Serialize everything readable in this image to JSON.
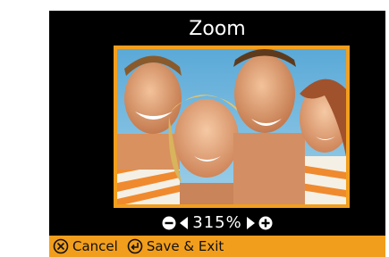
{
  "screen": {
    "title": "Zoom"
  },
  "zoom": {
    "value": "315%",
    "decrease_icon": "minus-circle-icon",
    "prev_icon": "left-triangle-icon",
    "next_icon": "right-triangle-icon",
    "increase_icon": "plus-circle-icon"
  },
  "footer": {
    "cancel_label": "Cancel",
    "cancel_icon": "cancel-circle-x-icon",
    "save_label": "Save & Exit",
    "save_icon": "enter-return-icon"
  },
  "colors": {
    "accent": "#f29e1d",
    "background": "#000000",
    "text": "#ffffff"
  }
}
